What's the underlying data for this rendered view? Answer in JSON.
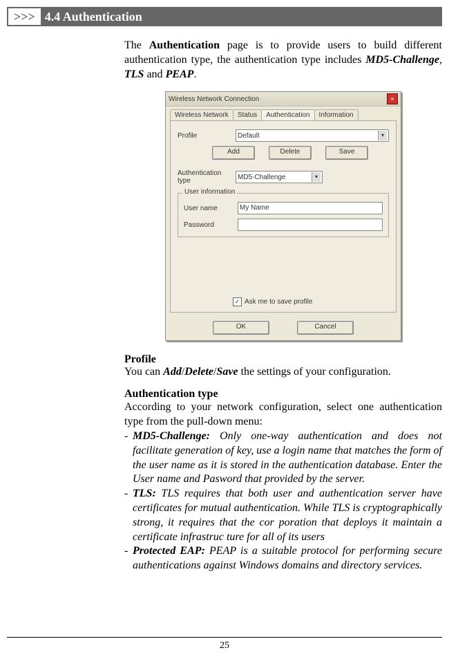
{
  "section": {
    "arrows": ">>>",
    "title": "4.4  Authentication"
  },
  "intro": {
    "p1a": "The ",
    "p1b": "Authentication",
    "p1c": " page is to provide users to build different authentication type, the authentication type includes ",
    "p1d": "MD5-Challenge",
    "p1e": ", ",
    "p1f": "TLS",
    "p1g": " and ",
    "p1h": "PEAP",
    "p1i": "."
  },
  "dialog": {
    "title": "Wireless Network Connection",
    "tabs": {
      "t1": "Wireless Network",
      "t2": "Status",
      "t3": "Authentication",
      "t4": "Information"
    },
    "profile_label": "Profile",
    "profile_value": "Default",
    "btn_add": "Add",
    "btn_delete": "Delete",
    "btn_save": "Save",
    "auth_label": "Authentication type",
    "auth_value": "MD5-Challenge",
    "group_legend": "User information",
    "user_label": "User name",
    "user_value": "My Name",
    "pass_label": "Password",
    "pass_value": "",
    "check_mark": "✓",
    "check_label": "Ask me to save profile",
    "btn_ok": "OK",
    "btn_cancel": "Cancel"
  },
  "profile": {
    "title": "Profile",
    "t1": "You can ",
    "t2": "Add",
    "t3": "/",
    "t4": "Delete",
    "t5": "/",
    "t6": "Save",
    "t7": " the settings of your configuration."
  },
  "auth": {
    "title": "Authentication type",
    "desc": "According to your network configuration, select one authentication type from the pull-down menu:",
    "b1_label": "MD5-Challenge:",
    "b1_text": " Only one-way authentication and does not facilitate generation of key, use a login name that matches the form of the user name as it is stored in the authentication database.  Enter the User name and Pasword that provided by the server.",
    "b2_label": "TLS:",
    "b2_text": " TLS requires that both user and authentication server have certificates for mutual authentication. While TLS is cryptographically strong, it requires that the cor poration that deploys it maintain a certificate infrastruc ture for all of its users",
    "b3_label": "Protected EAP:",
    "b3_text": " PEAP is a suitable protocol for performing secure authentications against Windows domains and directory services."
  },
  "page": "25"
}
